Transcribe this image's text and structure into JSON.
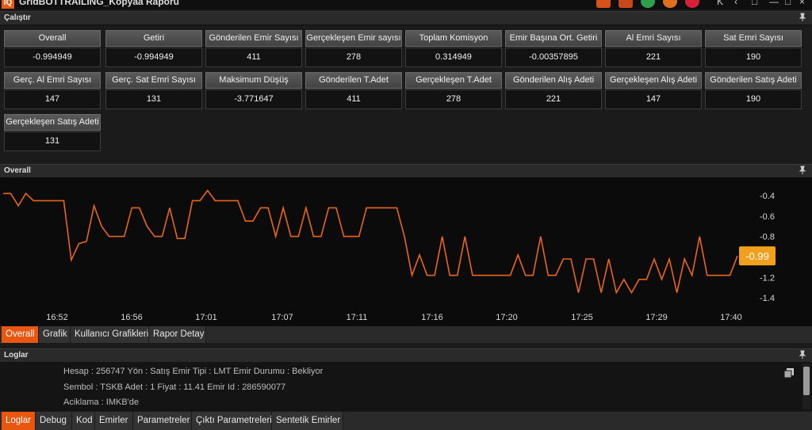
{
  "window": {
    "title": "GridBOTTRAILING_Kopyaa Raporu",
    "logo": "IQ",
    "icons": [
      "chart-icon",
      "shop-icon",
      "play-icon",
      "record-icon",
      "stop-icon"
    ],
    "controls": [
      "K",
      "<",
      "restore",
      "minimize",
      "close"
    ]
  },
  "calistir_panel": {
    "title": "Çalıştır",
    "stats": [
      {
        "label": "Overall",
        "value": "-0.994949"
      },
      {
        "label": "Getiri",
        "value": "-0.994949"
      },
      {
        "label": "Gönderilen Emir Sayısı",
        "value": "411"
      },
      {
        "label": "Gerçekleşen Emir sayısı",
        "value": "278"
      },
      {
        "label": "Toplam Komisyon",
        "value": "0.314949"
      },
      {
        "label": "Emir Başına Ort. Getiri",
        "value": "-0.00357895"
      },
      {
        "label": "Al Emri Sayısı",
        "value": "221"
      },
      {
        "label": "Sat Emri Sayısı",
        "value": "190"
      },
      {
        "label": "Gerç. Al Emri Sayısı",
        "value": "147"
      },
      {
        "label": "Gerç. Sat Emri Sayısı",
        "value": "131"
      },
      {
        "label": "Maksimum Düşüş",
        "value": "-3.771647"
      },
      {
        "label": "Gönderilen T.Adet",
        "value": "411"
      },
      {
        "label": "Gerçekleşen T.Adet",
        "value": "278"
      },
      {
        "label": "Gönderilen Alış Adeti",
        "value": "221"
      },
      {
        "label": "Gerçekleşen Alış Adeti",
        "value": "147"
      },
      {
        "label": "Gönderilen Satış Adeti",
        "value": "190"
      },
      {
        "label": "Gerçekleşen Satış Adeti",
        "value": "131"
      }
    ]
  },
  "overall_panel": {
    "title": "Overall",
    "tabs": [
      {
        "label": "Overall",
        "active": true
      },
      {
        "label": "Grafik",
        "active": false
      },
      {
        "label": "Kullanıcı Grafikleri",
        "active": false
      },
      {
        "label": "Rapor Detay",
        "active": false
      }
    ]
  },
  "chart_data": {
    "type": "line",
    "x_ticks": [
      "16:52",
      "16:56",
      "17:01",
      "17:07",
      "17:11",
      "17:16",
      "17:20",
      "17:25",
      "17:29",
      "17:40"
    ],
    "y_ticks": [
      -0.4,
      -0.6,
      -0.8,
      -1.0,
      -1.2,
      -1.4
    ],
    "ylim": [
      -1.5,
      -0.3
    ],
    "last_value_label": "-0.99",
    "line_color": "#e8661a",
    "label_color": "#f0a01c",
    "series": [
      {
        "values": [
          -0.38,
          -0.38,
          -0.5,
          -0.38,
          -0.45,
          -0.45,
          -0.45,
          -0.45,
          -0.45,
          -1.03,
          -0.87,
          -0.85,
          -0.5,
          -0.7,
          -0.8,
          -0.8,
          -0.8,
          -0.52,
          -0.52,
          -0.7,
          -0.8,
          -0.8,
          -0.52,
          -0.82,
          -0.82,
          -0.45,
          -0.45,
          -0.35,
          -0.45,
          -0.45,
          -0.45,
          -0.45,
          -0.65,
          -0.65,
          -0.52,
          -0.52,
          -0.8,
          -0.52,
          -0.8,
          -0.8,
          -0.52,
          -0.8,
          -0.8,
          -0.52,
          -0.52,
          -0.8,
          -0.8,
          -0.8,
          -0.52,
          -0.52,
          -0.52,
          -0.52,
          -0.52,
          -0.8,
          -1.18,
          -0.98,
          -1.18,
          -1.18,
          -0.8,
          -1.18,
          -1.18,
          -0.8,
          -1.18,
          -1.18,
          -1.18,
          -1.18,
          -1.18,
          -1.18,
          -0.98,
          -1.18,
          -1.18,
          -0.8,
          -1.18,
          -1.18,
          -1.02,
          -1.02,
          -1.35,
          -1.02,
          -1.02,
          -1.35,
          -1.02,
          -1.35,
          -1.22,
          -1.35,
          -1.22,
          -1.22,
          -1.02,
          -1.22,
          -1.02,
          -1.35,
          -1.02,
          -1.18,
          -0.8,
          -1.18,
          -1.18,
          -1.18,
          -1.18,
          -0.99
        ]
      }
    ]
  },
  "logs_panel": {
    "title": "Loglar",
    "lines": [
      "Hesap : 256747 Yön : Satış Emir Tipi : LMT Emir Durumu : Bekliyor",
      "Sembol : TSKB Adet : 1 Fiyat : 11.41 Emir Id : 286590077",
      "Aciklama :  IMKB'de"
    ],
    "tabs": [
      {
        "label": "Loglar",
        "active": true
      },
      {
        "label": "Debug",
        "active": false
      },
      {
        "label": "Kod",
        "active": false
      },
      {
        "label": "Emirler",
        "active": false
      },
      {
        "label": "Parametreler",
        "active": false
      },
      {
        "label": "Çıktı Parametreleri",
        "active": false
      },
      {
        "label": "Sentetik Emirler",
        "active": false
      }
    ]
  }
}
